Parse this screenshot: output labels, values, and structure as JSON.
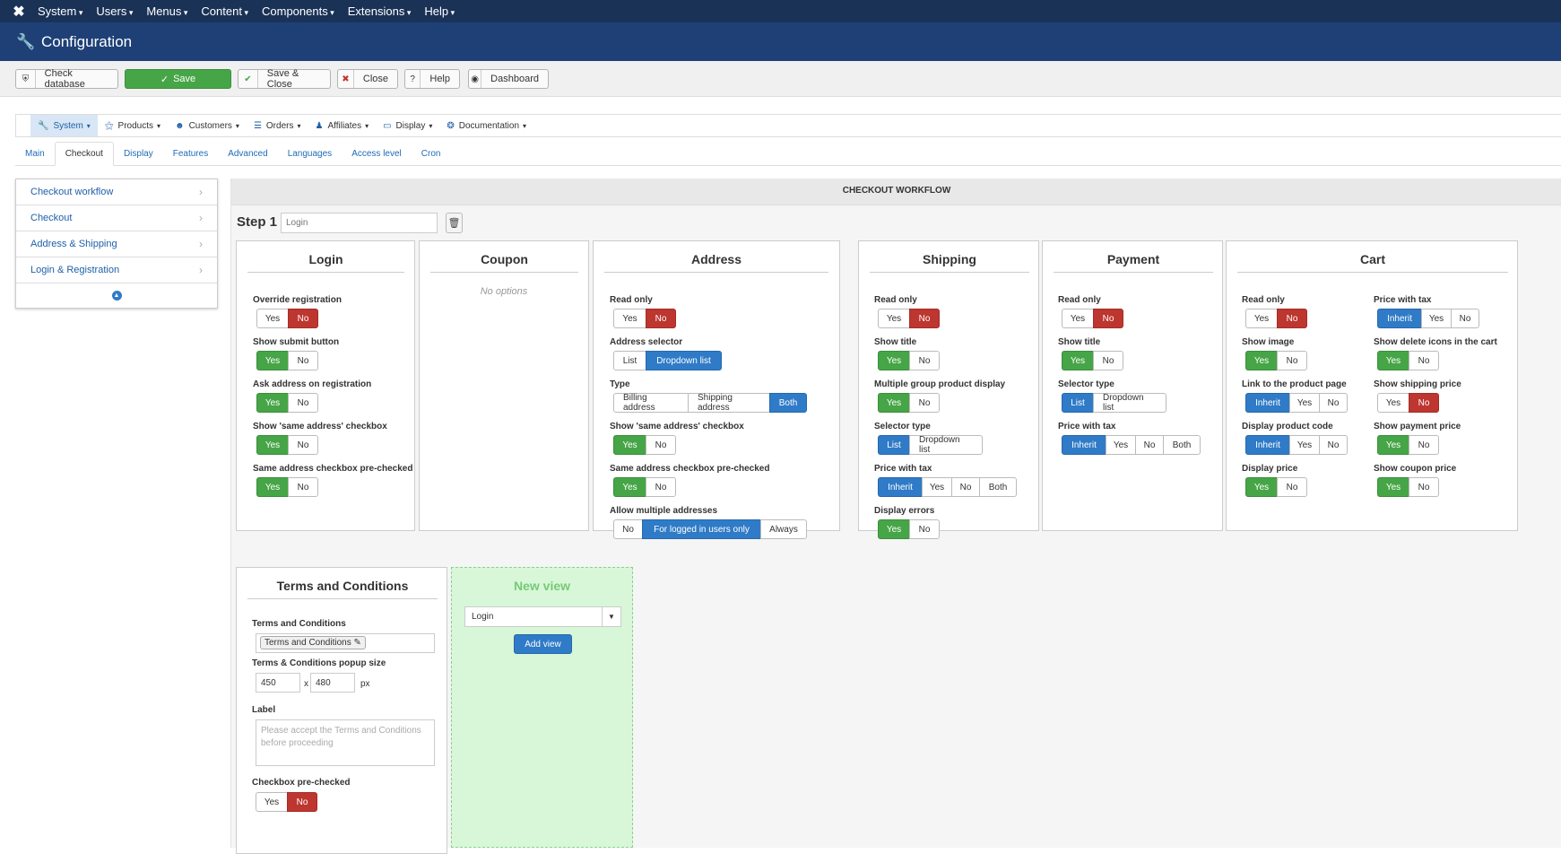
{
  "topnav": {
    "logo": "✖",
    "menu": [
      "System",
      "Users",
      "Menus",
      "Content",
      "Components",
      "Extensions",
      "Help"
    ]
  },
  "page_title": "Configuration",
  "toolbar": {
    "check_database": "Check database",
    "save": "Save",
    "save_close": "Save & Close",
    "close": "Close",
    "help": "Help",
    "dashboard": "Dashboard"
  },
  "submenu": [
    "System",
    "Products",
    "Customers",
    "Orders",
    "Affiliates",
    "Display",
    "Documentation"
  ],
  "tabs": [
    "Main",
    "Checkout",
    "Display",
    "Features",
    "Advanced",
    "Languages",
    "Access level",
    "Cron"
  ],
  "sidebar": [
    "Checkout workflow",
    "Checkout",
    "Address & Shipping",
    "Login & Registration"
  ],
  "workflow": {
    "header": "CHECKOUT WORKFLOW",
    "step_label": "Step 1",
    "step_placeholder": "Login"
  },
  "login": {
    "title": "Login",
    "f1": "Override registration",
    "f2": "Show submit button",
    "f3": "Ask address on registration",
    "f4": "Show 'same address' checkbox",
    "f5": "Same address checkbox pre-checked"
  },
  "coupon": {
    "title": "Coupon",
    "no_options": "No options"
  },
  "address": {
    "title": "Address",
    "f1": "Read only",
    "f2": "Address selector",
    "f3": "Type",
    "f4": "Show 'same address' checkbox",
    "f5": "Same address checkbox pre-checked",
    "f6": "Allow multiple addresses"
  },
  "shipping": {
    "title": "Shipping",
    "f1": "Read only",
    "f2": "Show title",
    "f3": "Multiple group product display",
    "f4": "Selector type",
    "f5": "Price with tax",
    "f6": "Display errors"
  },
  "payment": {
    "title": "Payment",
    "f1": "Read only",
    "f2": "Show title",
    "f3": "Selector type",
    "f4": "Price with tax"
  },
  "cart": {
    "title": "Cart",
    "l1": "Read only",
    "l2": "Show image",
    "l3": "Link to the product page",
    "l4": "Display product code",
    "l5": "Display price",
    "r1": "Price with tax",
    "r2": "Show delete icons in the cart",
    "r3": "Show shipping price",
    "r4": "Show payment price",
    "r5": "Show coupon price"
  },
  "terms": {
    "title": "Terms and Conditions",
    "f1": "Terms and Conditions",
    "tag": "Terms and Conditions",
    "f2": "Terms & Conditions popup size",
    "width": "450",
    "x": "x",
    "height": "480",
    "px": "px",
    "f3": "Label",
    "label_placeholder": "Please accept the Terms and Conditions before proceeding",
    "f4": "Checkbox pre-checked"
  },
  "newview": {
    "title": "New view",
    "selected": "Login",
    "add_btn": "Add view"
  },
  "opt": {
    "yes": "Yes",
    "no": "No",
    "list": "List",
    "dropdown": "Dropdown list",
    "billing": "Billing address",
    "shipping_addr": "Shipping address",
    "both": "Both",
    "inherit": "Inherit",
    "logged": "For logged in users only",
    "always": "Always"
  },
  "colors": {
    "nav_bg": "#1b3257",
    "title_bg": "#1e4076",
    "yes_green": "#46a546",
    "no_red": "#bd362f",
    "selected_blue": "#2f7bc7",
    "new_view_bg": "#d8f7d8"
  },
  "icons": {
    "logo": "joomla-icon",
    "title": "wrench-icon",
    "trash": "trash-icon"
  }
}
